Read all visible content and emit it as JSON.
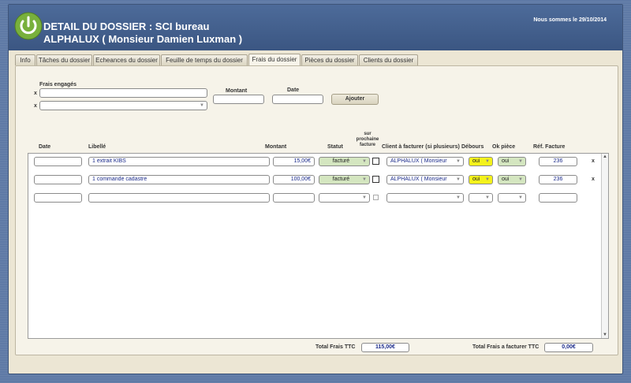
{
  "header": {
    "title_line1": "DETAIL DU DOSSIER : SCI bureau",
    "title_line2": "ALPHALUX ( Monsieur Damien Luxman )",
    "date_note": "Nous sommes le 29/10/2014"
  },
  "tabs": [
    {
      "label": "Info"
    },
    {
      "label": "Tâches du dossier"
    },
    {
      "label": "Echeances du dossier"
    },
    {
      "label": "Feuille de temps du dossier"
    },
    {
      "label": "Frais du dossier"
    },
    {
      "label": "Pièces du dossier"
    },
    {
      "label": "Clients du dossier"
    }
  ],
  "form": {
    "frais_label": "Frais engagés",
    "montant_label": "Montant",
    "date_label": "Date",
    "add_button": "Ajouter",
    "x": "x"
  },
  "columns": {
    "date": "Date",
    "libelle": "Libellé",
    "montant": "Montant",
    "statut": "Statut",
    "prochaine_line1": "sur",
    "prochaine_line2": "prochaine",
    "prochaine_line3": "facture",
    "client": "Client à facturer (si plusieurs)",
    "debours": "Débours",
    "ok_piece": "Ok pièce",
    "ref_facture": "Réf. Facture"
  },
  "rows": [
    {
      "date": "",
      "libelle": "1 extrait KIBS",
      "montant": "15,00€",
      "statut": "facturé",
      "client": "ALPHALUX ( Monsieur",
      "debours": "oui",
      "ok_piece": "oui",
      "ref": "236",
      "x": "x"
    },
    {
      "date": "",
      "libelle": "1 commande cadastre",
      "montant": "100,00€",
      "statut": "facturé",
      "client": "ALPHALUX ( Monsieur",
      "debours": "oui",
      "ok_piece": "oui",
      "ref": "236",
      "x": "x"
    }
  ],
  "totals": {
    "frais_label": "Total Frais TTC",
    "frais_value": "115,00€",
    "a_facturer_label": "Total Frais a facturer TTC",
    "a_facturer_value": "0,00€"
  },
  "colors": {
    "header_bg": "#425f8e",
    "panel_bg": "#f6f3e9",
    "accent_green": "#78b03c",
    "debours_yellow": "#f4f21c",
    "status_green": "#d4e6c0"
  }
}
